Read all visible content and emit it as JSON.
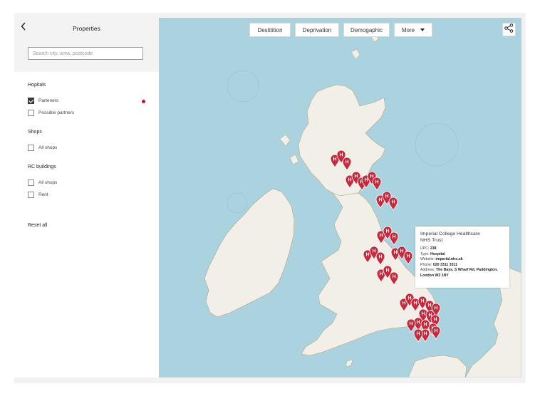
{
  "sidebar": {
    "title": "Properties",
    "search_placeholder": "Search city, area, postcode",
    "sections": [
      {
        "title": "Hopitals",
        "options": [
          {
            "label": "Parteners",
            "checked": true
          },
          {
            "label": "Possible partners",
            "checked": false
          }
        ]
      },
      {
        "title": "Shops",
        "options": [
          {
            "label": "All shops",
            "checked": false
          }
        ]
      },
      {
        "title": "RC buildings",
        "options": [
          {
            "label": "All shops",
            "checked": false
          },
          {
            "label": "Rent",
            "checked": false
          }
        ]
      }
    ],
    "reset_label": "Reset all"
  },
  "tabs": [
    {
      "label": "Destitition"
    },
    {
      "label": "Deprivation"
    },
    {
      "label": "Demogaphic"
    },
    {
      "label": "More",
      "has_caret": true
    }
  ],
  "map": {
    "marker_letter": "H",
    "marker_color": "#c8283b",
    "sea_color": "#aad3df",
    "land_color": "#f2efe9"
  },
  "popup": {
    "title": "Imperial College Healthcare NHS Trust",
    "rows": [
      {
        "key": "UPC:",
        "value": "238"
      },
      {
        "key": "Type:",
        "value": "Hospital"
      },
      {
        "key": "Website:",
        "value": "imperial.nhs.uk"
      },
      {
        "key": "Phone:",
        "value": "020 3311 3311"
      },
      {
        "key": "Address:",
        "value": "The Bays, S Wharf Rd, Paddington, London W2 1NY"
      }
    ]
  },
  "icons": {
    "back": "chevron-left-icon",
    "share": "share-icon",
    "more_caret": "caret-down-icon"
  }
}
